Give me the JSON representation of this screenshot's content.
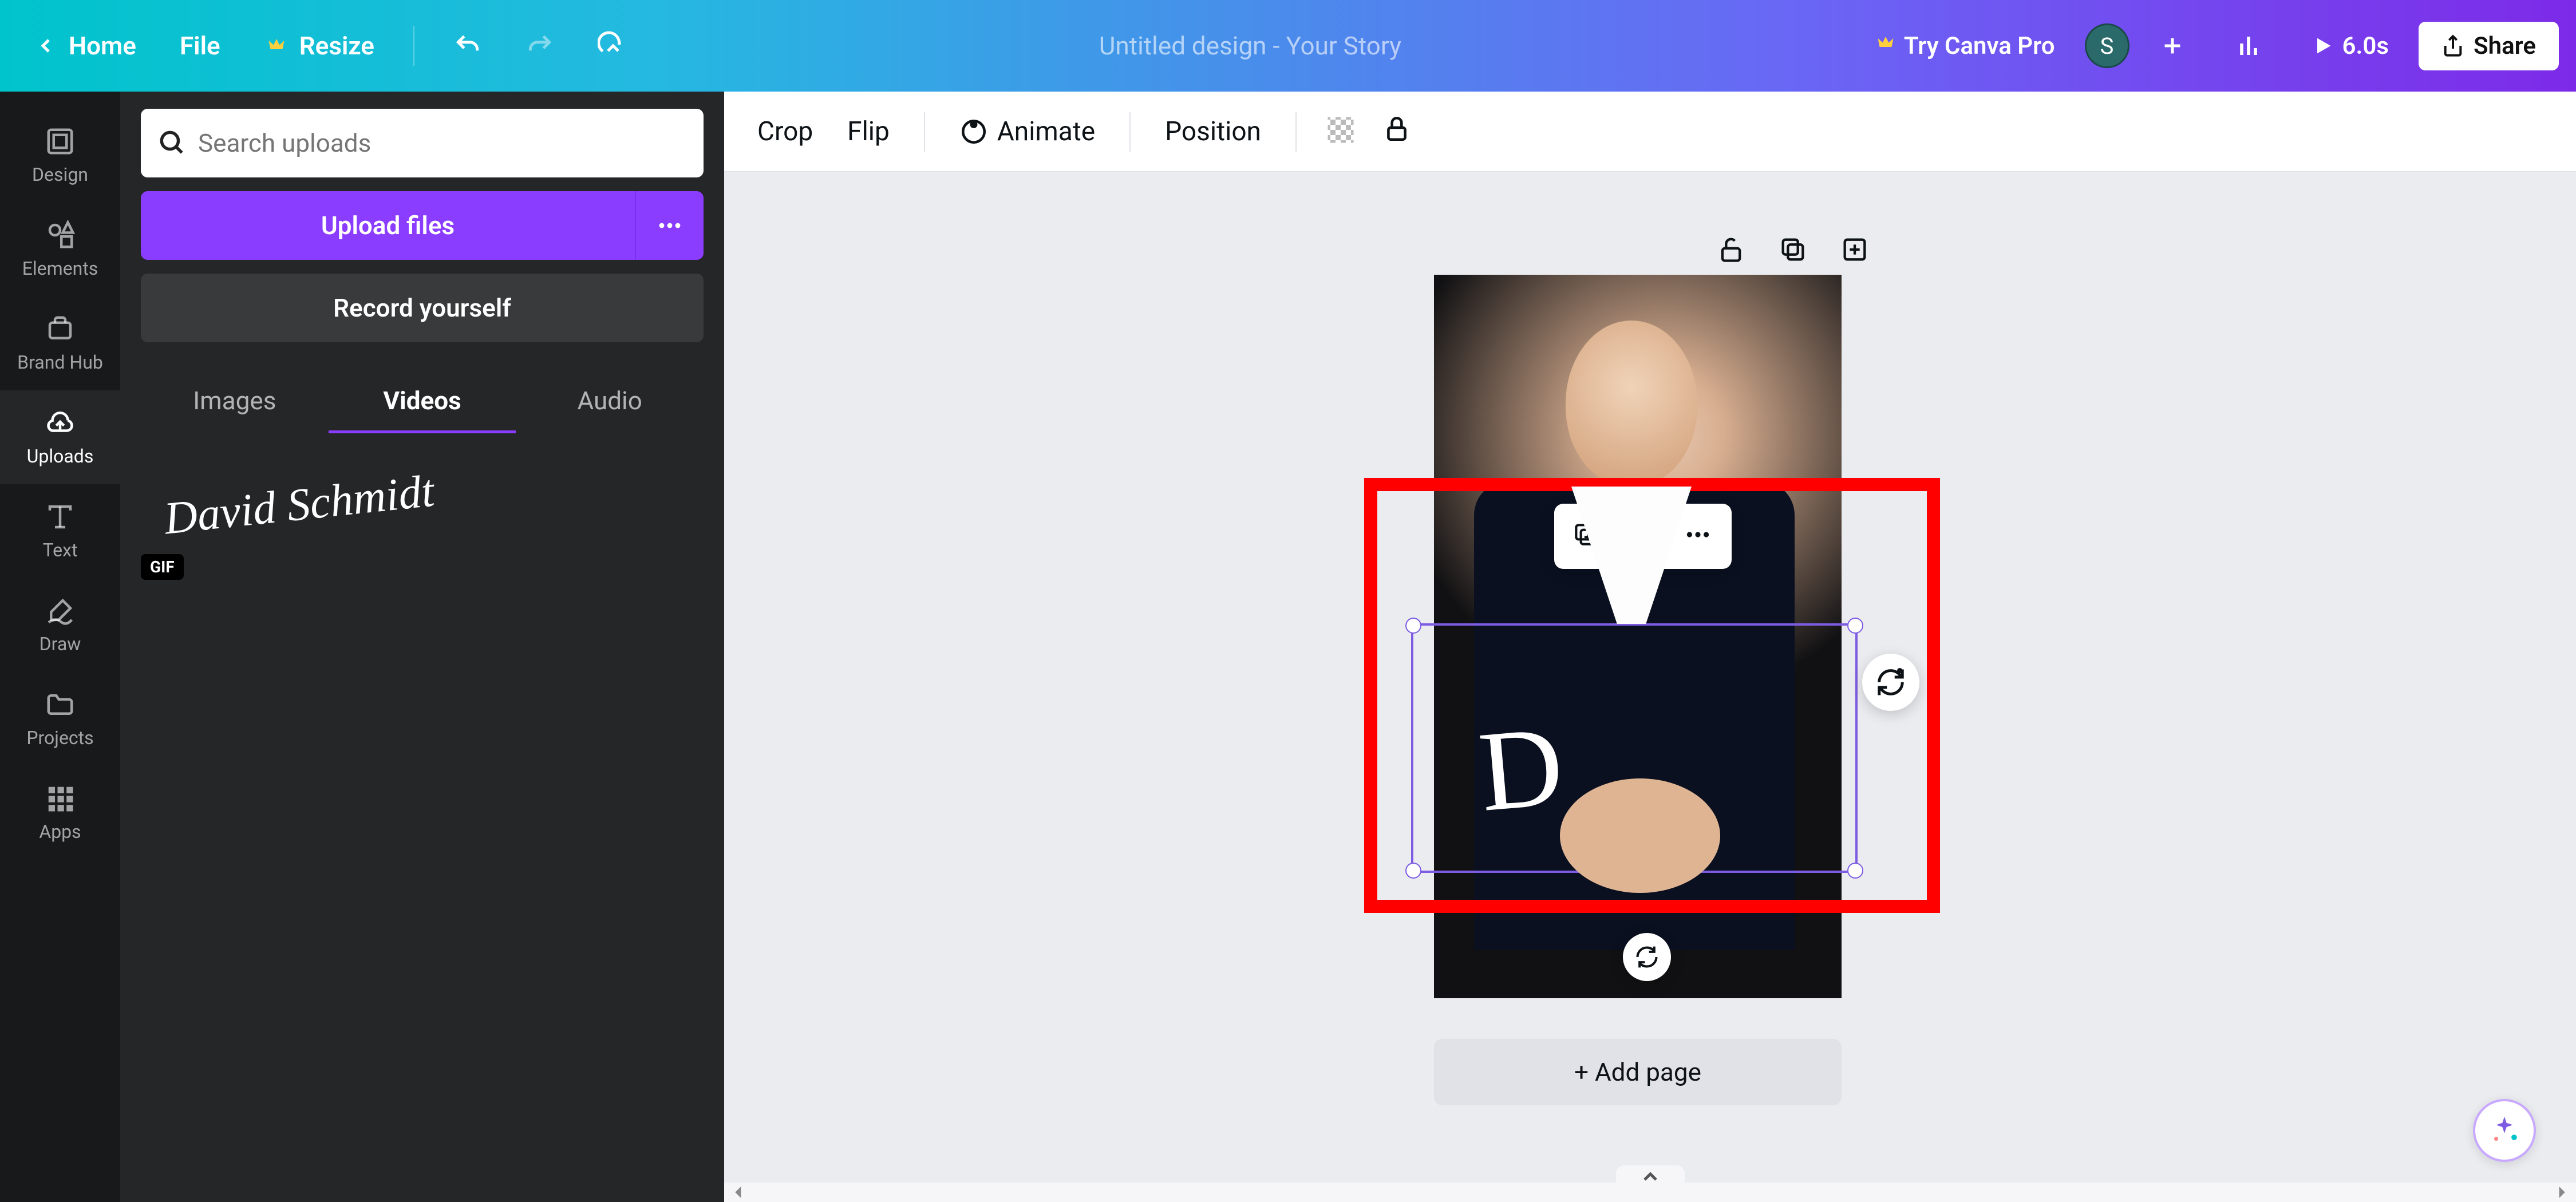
{
  "header": {
    "home": "Home",
    "file": "File",
    "resize": "Resize",
    "title": "Untitled design - Your Story",
    "try_pro": "Try Canva Pro",
    "duration": "6.0s",
    "share": "Share",
    "avatar_initial": "S"
  },
  "rail": {
    "design": "Design",
    "elements": "Elements",
    "brand_hub": "Brand Hub",
    "uploads": "Uploads",
    "text": "Text",
    "draw": "Draw",
    "projects": "Projects",
    "apps": "Apps"
  },
  "panel": {
    "search_placeholder": "Search uploads",
    "upload_btn": "Upload files",
    "record_btn": "Record yourself",
    "tabs": {
      "images": "Images",
      "videos": "Videos",
      "audio": "Audio"
    },
    "active_tab": "Videos",
    "signature_text": "David Schmidt",
    "gif_badge": "GIF"
  },
  "toolbar": {
    "crop": "Crop",
    "flip": "Flip",
    "animate": "Animate",
    "position": "Position"
  },
  "canvas": {
    "add_page": "+ Add page",
    "signature_preview": "D"
  },
  "colors": {
    "accent": "#8b3dff",
    "highlight": "#ff0000",
    "selection": "#7d5ce3"
  }
}
